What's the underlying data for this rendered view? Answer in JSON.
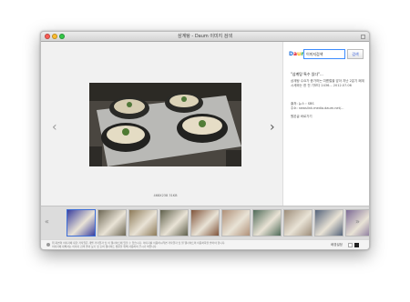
{
  "window": {
    "title": "삼계탕 - Daum 이미지 검색"
  },
  "viewer": {
    "prev_arrow": "‹",
    "next_arrow": "›",
    "dimensions": "468X238   31KB"
  },
  "info_panel": {
    "logo": [
      "D",
      "a",
      "u",
      "m"
    ],
    "search_value": "이미지검색",
    "search_button": "검색",
    "title": "\"삼계탕 특수 있다\"...",
    "description": "삼계탕 수요가 증가하는 여름철을 앞아 지난 2분기 폐계 시세와는 한 전 기보다 2436...   2012.07.06",
    "source_label": "출처: 뉴스 › SBS",
    "source_url": "주소: newslink.media.daum.net/...",
    "related_link": "원본글 바로가기"
  },
  "strip": {
    "left_arrow": "«",
    "right_arrow": "»",
    "thumbnails": [
      {
        "name": "thumbnail-1",
        "color": "#3b3f9e"
      },
      {
        "name": "thumbnail-2",
        "color": "#6d6754"
      },
      {
        "name": "thumbnail-3",
        "color": "#8c7a58"
      },
      {
        "name": "thumbnail-4",
        "color": "#5f604b"
      },
      {
        "name": "thumbnail-5",
        "color": "#80543b"
      },
      {
        "name": "thumbnail-6",
        "color": "#b09078"
      },
      {
        "name": "thumbnail-7",
        "color": "#4f6b58"
      },
      {
        "name": "thumbnail-8",
        "color": "#9d8d7a"
      },
      {
        "name": "thumbnail-9",
        "color": "#54637a"
      },
      {
        "name": "thumbnail-10",
        "color": "#7c6a95"
      }
    ]
  },
  "footer": {
    "notice": "위 화면의 이미지에 대한 저작권은 개별 저작권자 및 이 웹사이트에 있을 수 있습니다. 이미지를 이용하시려면 저작권자 및 원 웹사이트의 이용허락을 받아야 합니다.",
    "notice_2": "이미지에 대해서는 이미지 검색 결과 보기 및 출처 웹사이트 방문을 위해 사용하여 주시기 바랍니다.",
    "right_label": "배경설정"
  },
  "colors": {
    "accent": "#3b6dd8",
    "window_bg": "#f1f1f1"
  }
}
